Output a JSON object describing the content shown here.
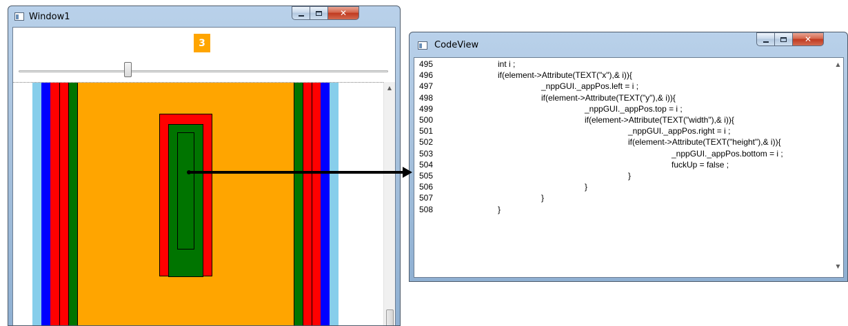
{
  "window1": {
    "title": "Window1",
    "counter_badge": "3",
    "slider_value_fraction": 0.3,
    "colors": {
      "orange": "#ffa500",
      "green": "#007400",
      "red": "#ff0000",
      "blue": "#0000ff",
      "light_blue": "#87ceeb"
    }
  },
  "codeview": {
    "title": "CodeView",
    "lines": [
      {
        "number": "495",
        "indent": 0,
        "text": "int i ;"
      },
      {
        "number": "496",
        "indent": 0,
        "text": "if(element->Attribute(TEXT(\"x\"),& i)){"
      },
      {
        "number": "497",
        "indent": 1,
        "text": "_nppGUI._appPos.left = i ;"
      },
      {
        "number": "498",
        "indent": 1,
        "text": "if(element->Attribute(TEXT(\"y\"),& i)){"
      },
      {
        "number": "499",
        "indent": 2,
        "text": "_nppGUI._appPos.top = i ;"
      },
      {
        "number": "500",
        "indent": 2,
        "text": "if(element->Attribute(TEXT(\"width\"),& i)){"
      },
      {
        "number": "501",
        "indent": 3,
        "text": "_nppGUI._appPos.right = i ;"
      },
      {
        "number": "502",
        "indent": 3,
        "text": "if(element->Attribute(TEXT(\"height\"),& i)){"
      },
      {
        "number": "503",
        "indent": 4,
        "text": "_nppGUI._appPos.bottom = i ;"
      },
      {
        "number": "504",
        "indent": 4,
        "text": "fuckUp = false ;"
      },
      {
        "number": "505",
        "indent": 3,
        "text": "}"
      },
      {
        "number": "506",
        "indent": 2,
        "text": "}"
      },
      {
        "number": "507",
        "indent": 1,
        "text": "}"
      },
      {
        "number": "508",
        "indent": 0,
        "text": "}"
      }
    ]
  },
  "icons": {
    "minimize": "minimize-icon",
    "maximize": "maximize-icon",
    "close": "close-icon",
    "window_app": "window-app-icon",
    "scroll_up": "scroll-up-arrow-icon",
    "scroll_down": "scroll-down-arrow-icon",
    "connector_arrow": "arrow-icon"
  }
}
